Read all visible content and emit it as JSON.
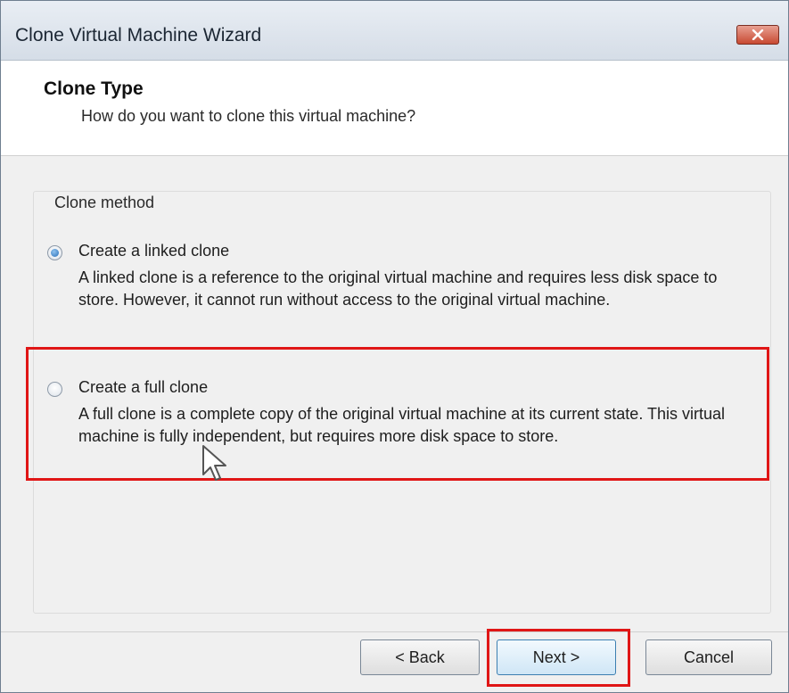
{
  "window": {
    "title": "Clone Virtual Machine Wizard"
  },
  "header": {
    "title": "Clone Type",
    "subtitle": "How do you want to clone this virtual machine?"
  },
  "clone_method": {
    "legend": "Clone method",
    "options": [
      {
        "label": "Create a linked clone",
        "checked": true,
        "description": "A linked clone is a reference to the original virtual machine and requires less disk space to store. However, it cannot run without access to the original virtual machine."
      },
      {
        "label": "Create a full clone",
        "checked": false,
        "description": "A full clone is a complete copy of the original virtual machine at its current state. This virtual machine is fully independent, but requires more disk space to store."
      }
    ]
  },
  "buttons": {
    "back": "< Back",
    "next": "Next >",
    "cancel": "Cancel"
  },
  "colors": {
    "highlight": "#e01616",
    "radio_selected": "#2a6fb8"
  }
}
